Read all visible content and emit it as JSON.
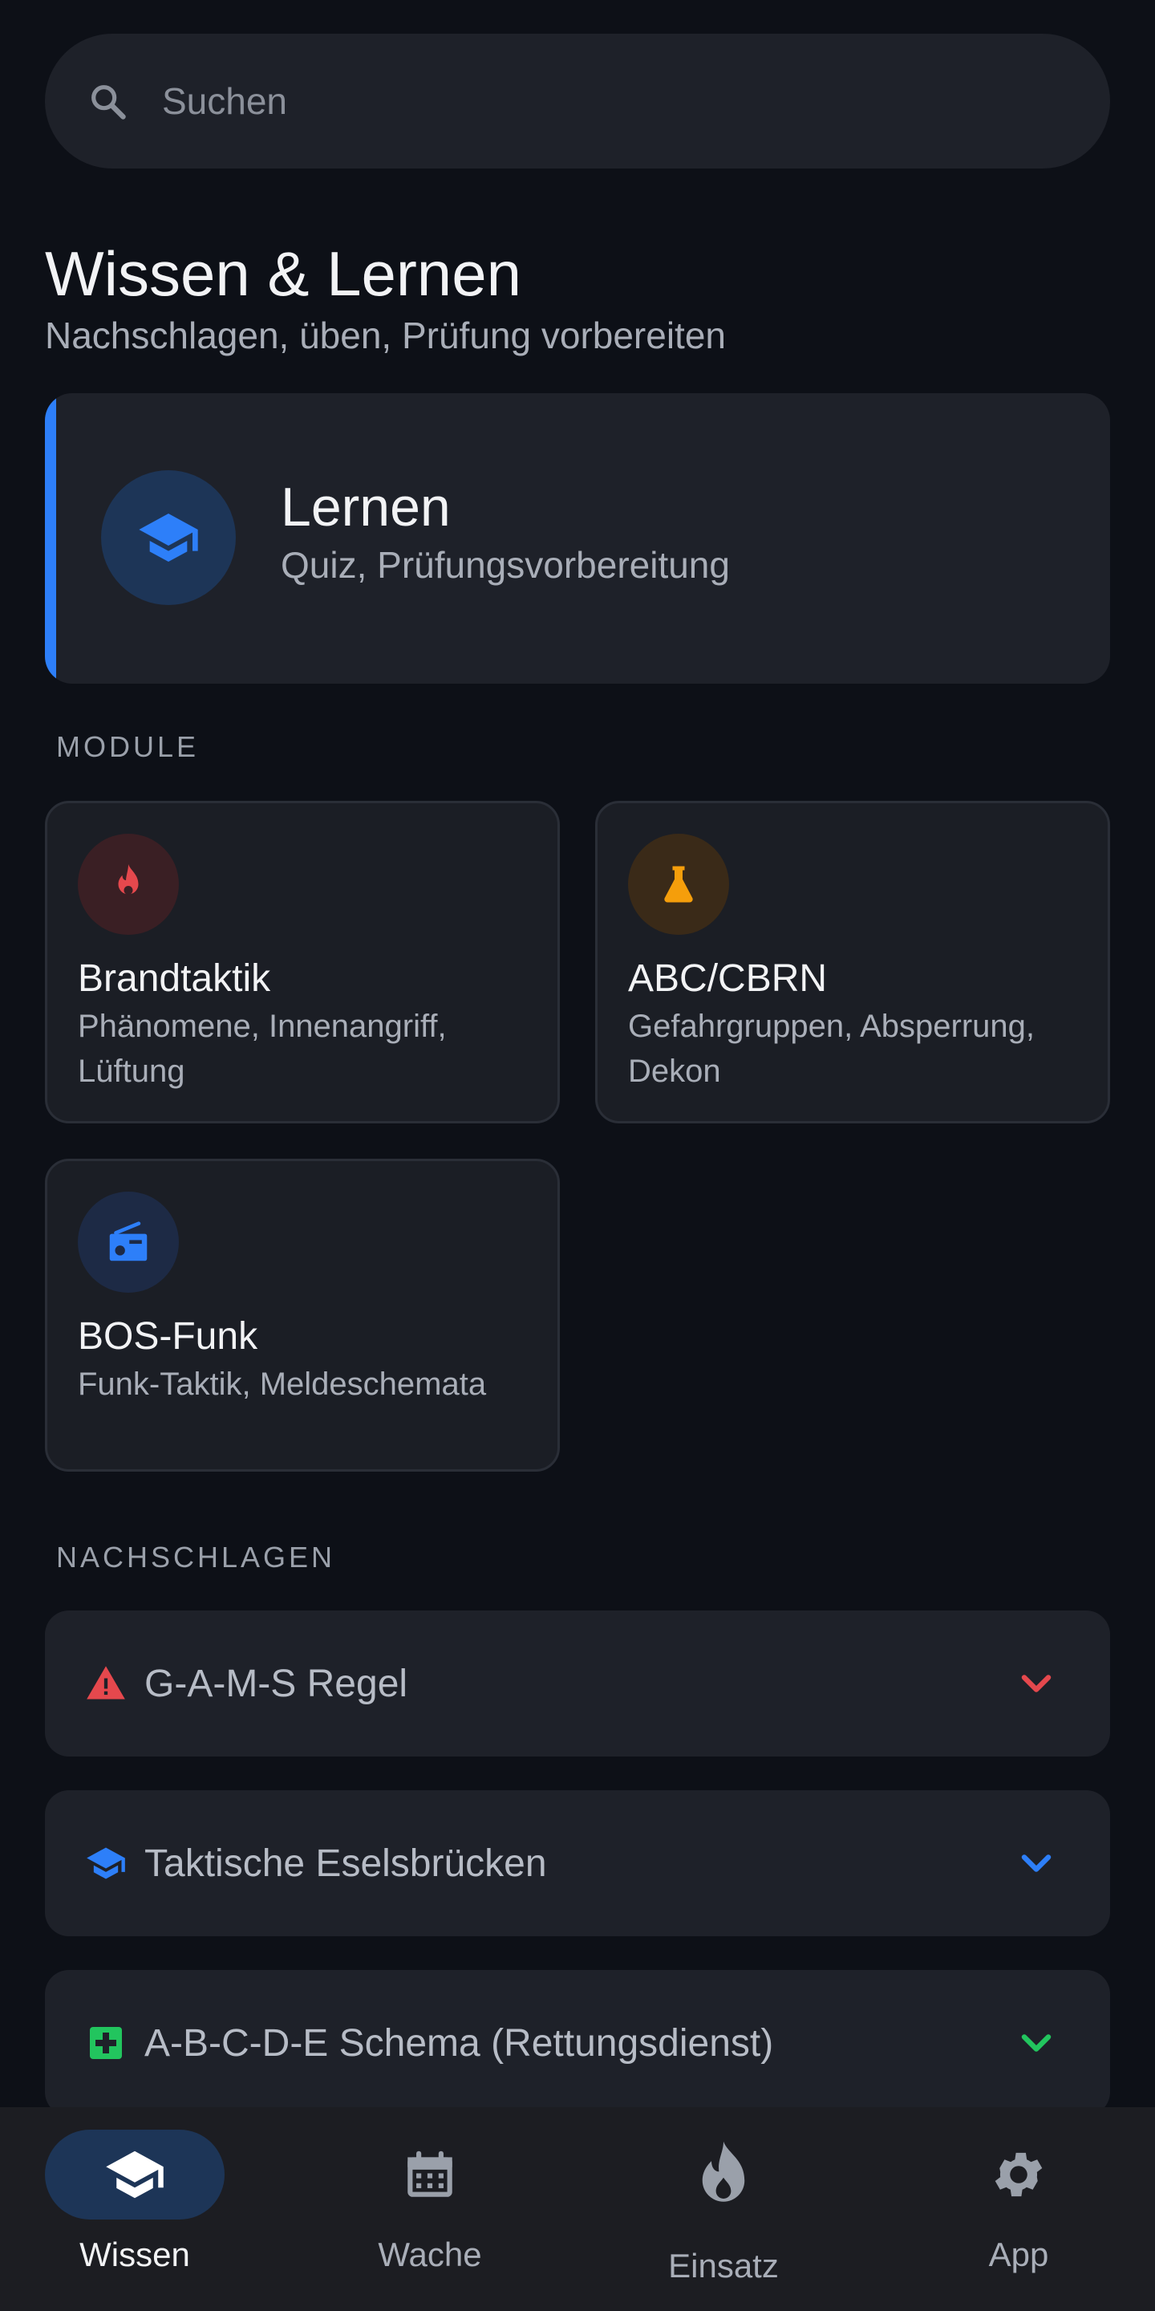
{
  "search": {
    "placeholder": "Suchen"
  },
  "page": {
    "title": "Wissen & Lernen",
    "subtitle": "Nachschlagen, üben, Prüfung vorbereiten"
  },
  "hero": {
    "title": "Lernen",
    "description": "Quiz, Prüfungsvorbereitung",
    "icon": "graduation-cap-icon",
    "accent_color": "#2d7ff9"
  },
  "modules": {
    "heading": "MODULE",
    "items": [
      {
        "title": "Brandtaktik",
        "description": "Phänomene, Innenangriff, Lüftung",
        "icon": "fire-icon",
        "color": "#e5484d"
      },
      {
        "title": "ABC/CBRN",
        "description": "Gefahrgruppen, Absperrung, Dekon",
        "icon": "flask-icon",
        "color": "#f59e0b"
      },
      {
        "title": "BOS-Funk",
        "description": "Funk-Taktik, Meldeschemata",
        "icon": "radio-icon",
        "color": "#2d7ff9"
      }
    ]
  },
  "reference": {
    "heading": "NACHSCHLAGEN",
    "items": [
      {
        "label": "G-A-M-S Regel",
        "icon": "warning-icon",
        "color": "#e5484d"
      },
      {
        "label": "Taktische Eselsbrücken",
        "icon": "graduation-cap-icon",
        "color": "#2d7ff9"
      },
      {
        "label": "A-B-C-D-E Schema (Rettungsdienst)",
        "icon": "medical-plus-icon",
        "color": "#22c55e"
      }
    ]
  },
  "nav": {
    "items": [
      {
        "label": "Wissen",
        "icon": "graduation-cap-icon",
        "active": true
      },
      {
        "label": "Wache",
        "icon": "calendar-icon",
        "active": false
      },
      {
        "label": "Einsatz",
        "icon": "flame-icon",
        "active": false
      },
      {
        "label": "App",
        "icon": "gear-icon",
        "active": false
      }
    ]
  }
}
